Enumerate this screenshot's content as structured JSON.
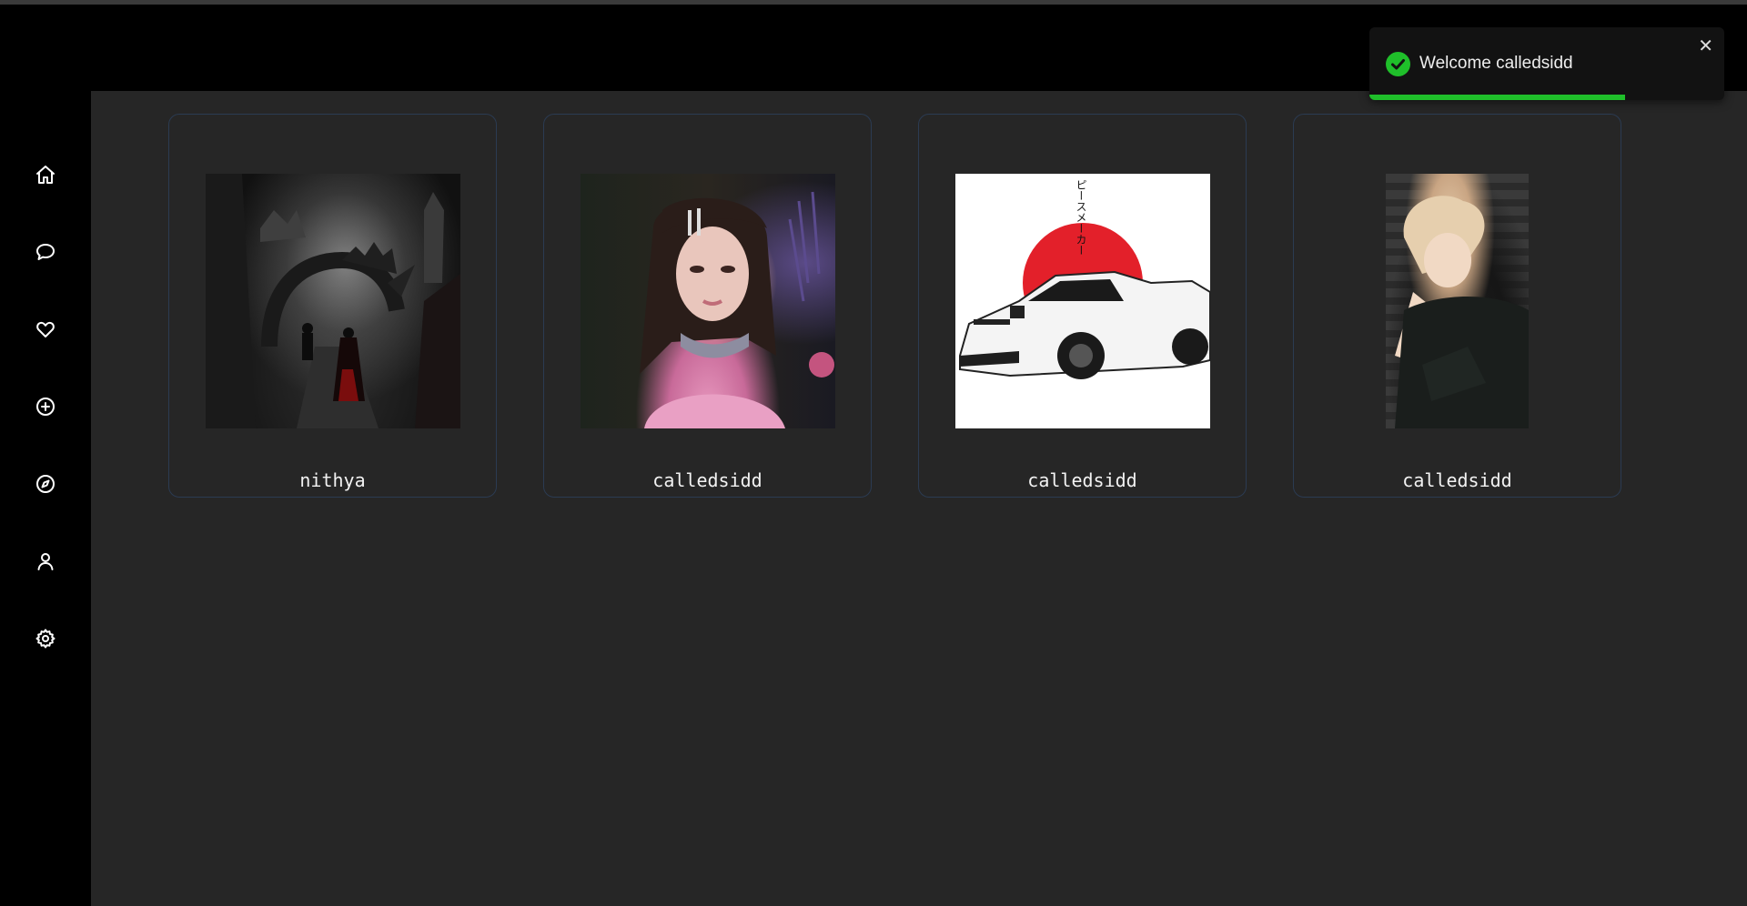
{
  "sidebar": {
    "items": [
      {
        "icon": "home-icon",
        "label": "Home"
      },
      {
        "icon": "chat-icon",
        "label": "Messages"
      },
      {
        "icon": "heart-icon",
        "label": "Likes"
      },
      {
        "icon": "plus-circle-icon",
        "label": "Create"
      },
      {
        "icon": "compass-icon",
        "label": "Explore"
      },
      {
        "icon": "user-icon",
        "label": "Profile"
      },
      {
        "icon": "gear-icon",
        "label": "Settings"
      }
    ]
  },
  "posts": [
    {
      "username": "nithya",
      "image": "dark-fantasy-dragon-gate"
    },
    {
      "username": "calledsidd",
      "image": "girl-portrait-pink"
    },
    {
      "username": "calledsidd",
      "image": "white-sports-car-red-sun"
    },
    {
      "username": "calledsidd",
      "image": "blonde-anime-boy"
    }
  ],
  "car_art": {
    "katakana": "ピースメーカー"
  },
  "toast": {
    "message": "Welcome calledsidd",
    "close_symbol": "✕",
    "progress": 0.72
  },
  "colors": {
    "success": "#1fbf2a",
    "accent_border": "#2b3b52",
    "main_bg": "#262626"
  }
}
